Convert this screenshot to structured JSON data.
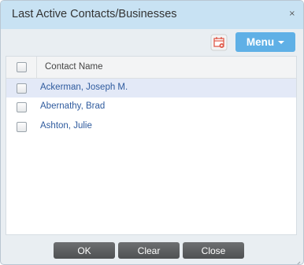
{
  "dialog": {
    "title": "Last Active Contacts/Businesses",
    "close_glyph": "×"
  },
  "toolbar": {
    "calendar_icon": "calendar-icon",
    "menu_label": "Menu"
  },
  "grid": {
    "column_header": "Contact Name",
    "rows": [
      {
        "name": "Ackerman, Joseph M.",
        "selected": true
      },
      {
        "name": "Abernathy, Brad",
        "selected": false
      },
      {
        "name": "Ashton, Julie",
        "selected": false
      }
    ]
  },
  "footer": {
    "ok_label": "OK",
    "clear_label": "Clear",
    "close_label": "Close"
  },
  "colors": {
    "titlebar": "#c8e2f3",
    "menu_button": "#5fb0e6",
    "link_text": "#2f5b9e",
    "selected_row": "#e3e9f7",
    "footer_button": "#5a5c5e"
  }
}
